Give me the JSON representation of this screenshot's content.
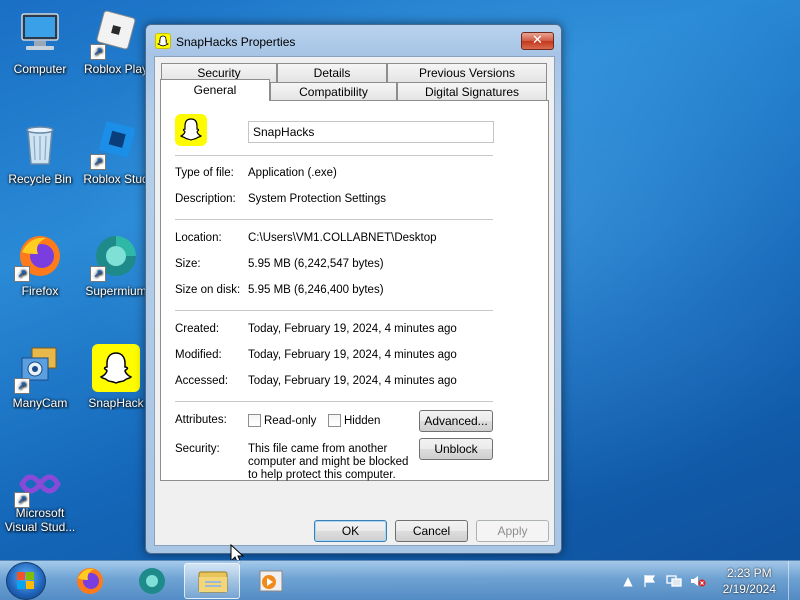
{
  "desktop": {
    "icons": [
      {
        "label": "Computer"
      },
      {
        "label": "Roblox Play"
      },
      {
        "label": "Recycle Bin"
      },
      {
        "label": "Roblox Stud"
      },
      {
        "label": "Firefox"
      },
      {
        "label": "Supermium"
      },
      {
        "label": "ManyCam"
      },
      {
        "label": "SnapHack"
      },
      {
        "label": "Microsoft"
      },
      {
        "label": "Visual Stud..."
      }
    ]
  },
  "window": {
    "title": "SnapHacks Properties",
    "close_label": "✕",
    "tabs": {
      "row_back": [
        "Security",
        "Details",
        "Previous Versions"
      ],
      "row_front": [
        "General",
        "Compatibility",
        "Digital Signatures"
      ],
      "active": "General"
    },
    "general": {
      "name": "SnapHacks",
      "type_label": "Type of file:",
      "type_value": "Application (.exe)",
      "description_label": "Description:",
      "description_value": "System Protection Settings",
      "location_label": "Location:",
      "location_value": "C:\\Users\\VM1.COLLABNET\\Desktop",
      "size_label": "Size:",
      "size_value": "5.95 MB (6,242,547 bytes)",
      "size_on_disk_label": "Size on disk:",
      "size_on_disk_value": "5.95 MB (6,246,400 bytes)",
      "created_label": "Created:",
      "created_value": "Today, February 19, 2024, 4 minutes ago",
      "modified_label": "Modified:",
      "modified_value": "Today, February 19, 2024, 4 minutes ago",
      "accessed_label": "Accessed:",
      "accessed_value": "Today, February 19, 2024, 4 minutes ago",
      "attributes_label": "Attributes:",
      "readonly_label": "Read-only",
      "readonly_checked": false,
      "hidden_label": "Hidden",
      "hidden_checked": false,
      "advanced_label": "Advanced...",
      "security_label": "Security:",
      "security_text": "This file came from another computer and might be blocked to help protect this computer.",
      "unblock_label": "Unblock"
    },
    "buttons": {
      "ok": "OK",
      "cancel": "Cancel",
      "apply": "Apply"
    }
  },
  "taskbar": {
    "time": "2:23 PM",
    "date": "2/19/2024"
  },
  "colors": {
    "snapchat_yellow": "#fffc00",
    "close_red": "#c2381d"
  }
}
